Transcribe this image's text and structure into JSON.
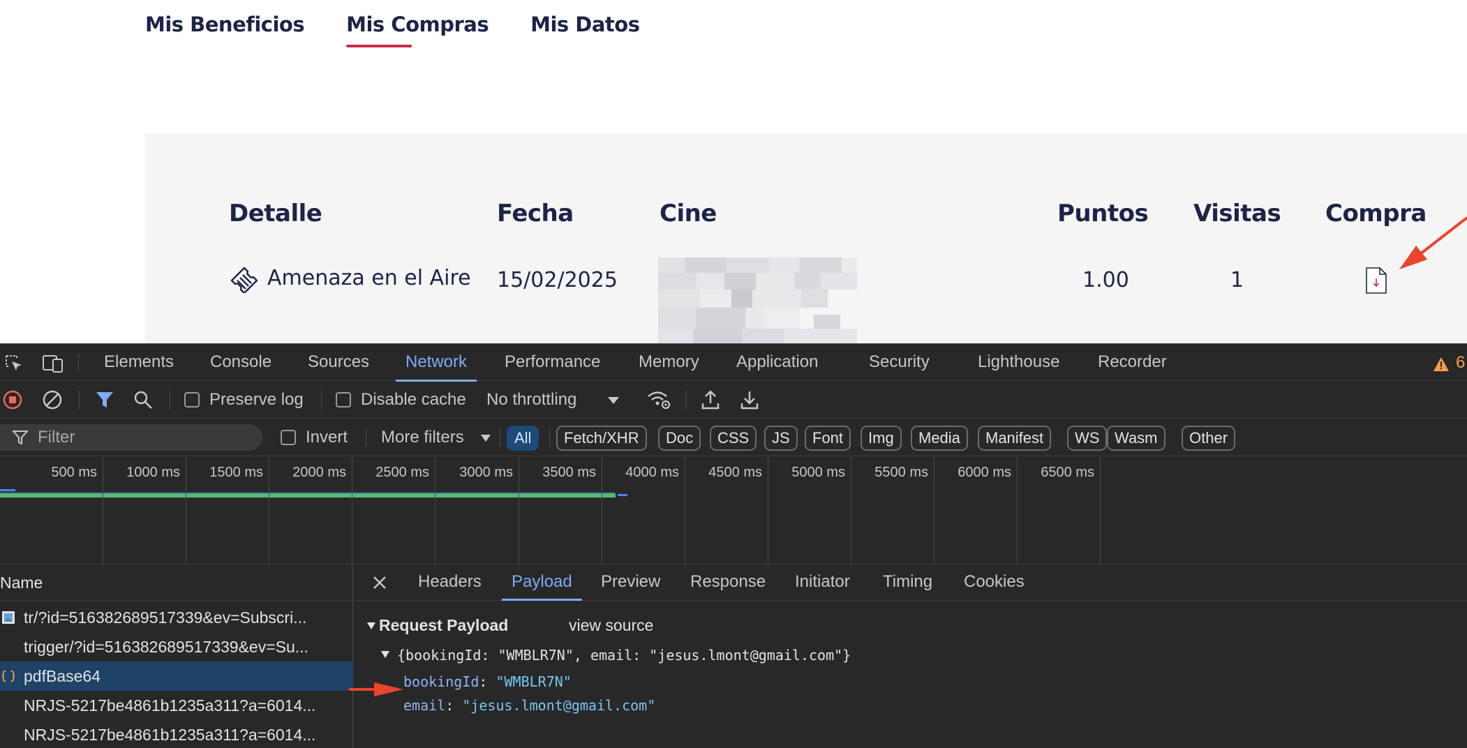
{
  "site": {
    "tabs": [
      {
        "label": "Mis Beneficios",
        "active": false
      },
      {
        "label": "Mis Compras",
        "active": true
      },
      {
        "label": "Mis Datos",
        "active": false
      }
    ],
    "table": {
      "headers": [
        "Detalle",
        "Fecha",
        "Cine",
        "Puntos",
        "Visitas",
        "Compra"
      ],
      "row": {
        "detalle": "Amenaza en el Aire",
        "fecha": "15/02/2025",
        "puntos": "1.00",
        "visitas": "1"
      }
    },
    "accent": "#d12a4a",
    "text_color": "#1c2447"
  },
  "devtools": {
    "tabs": [
      "Elements",
      "Console",
      "Sources",
      "Network",
      "Performance",
      "Memory",
      "Application",
      "Security",
      "Lighthouse",
      "Recorder"
    ],
    "active_tab": "Network",
    "warning_count": "6",
    "toolbar": {
      "preserve_log": "Preserve log",
      "disable_cache": "Disable cache",
      "throttling": "No throttling"
    },
    "filter": {
      "placeholder": "Filter",
      "invert": "Invert",
      "more_filters": "More filters",
      "chips": [
        "All",
        "Fetch/XHR",
        "Doc",
        "CSS",
        "JS",
        "Font",
        "Img",
        "Media",
        "Manifest",
        "WS",
        "Wasm",
        "Other"
      ],
      "active_chip": "All"
    },
    "timeline": {
      "ticks": [
        "500 ms",
        "1000 ms",
        "1500 ms",
        "2000 ms",
        "2500 ms",
        "3000 ms",
        "3500 ms",
        "4000 ms",
        "4500 ms",
        "5000 ms",
        "5500 ms",
        "6000 ms",
        "6500 ms"
      ]
    },
    "requests": {
      "header": "Name",
      "items": [
        {
          "name": "tr/?id=516382689517339&ev=Subscri...",
          "icon": "image-icon",
          "selected": false
        },
        {
          "name": "trigger/?id=516382689517339&ev=Su...",
          "icon": "none",
          "selected": false
        },
        {
          "name": "pdfBase64",
          "icon": "fetch-braces-icon",
          "selected": true
        },
        {
          "name": "NRJS-5217be4861b1235a311?a=6014...",
          "icon": "none",
          "selected": false
        },
        {
          "name": "NRJS-5217be4861b1235a311?a=6014...",
          "icon": "none",
          "selected": false
        }
      ]
    },
    "detail": {
      "tabs": [
        "Headers",
        "Payload",
        "Preview",
        "Response",
        "Initiator",
        "Timing",
        "Cookies"
      ],
      "active_tab": "Payload",
      "payload_title": "Request Payload",
      "view_source": "view source",
      "summary": "{bookingId: \"WMBLR7N\", email: \"jesus.lmont@gmail.com\"}",
      "fields": [
        {
          "key": "bookingId",
          "value": "\"WMBLR7N\""
        },
        {
          "key": "email",
          "value": "\"jesus.lmont@gmail.com\""
        }
      ]
    },
    "accent": "#7cacf8",
    "annotation_color": "#e8452c"
  }
}
